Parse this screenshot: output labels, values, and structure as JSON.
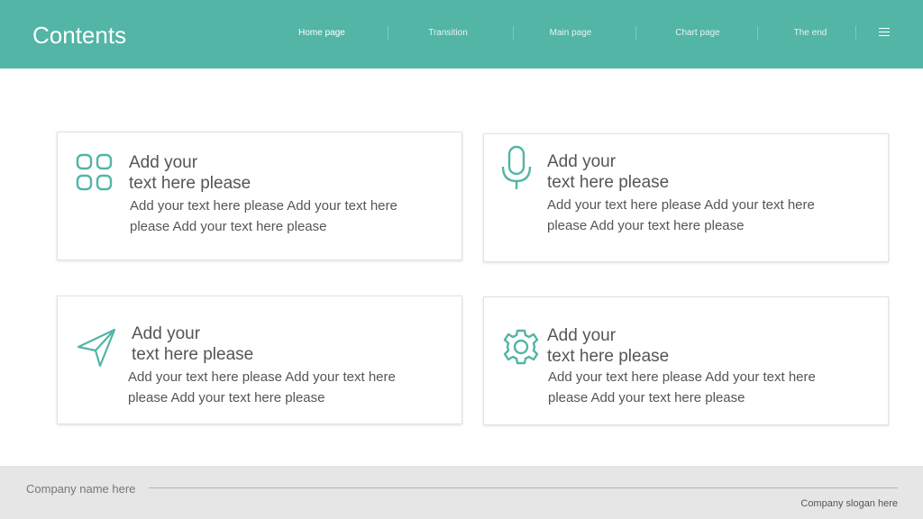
{
  "header": {
    "title": "Contents",
    "nav": [
      {
        "label": "Home  page"
      },
      {
        "label": "Transition"
      },
      {
        "label": "Main page"
      },
      {
        "label": "Chart page"
      },
      {
        "label": "The end"
      }
    ],
    "menu_icon": "menu-icon"
  },
  "colors": {
    "accent": "#52b5a6",
    "footer_bg": "#e6e6e6",
    "text": "#555555"
  },
  "cards": [
    {
      "icon": "apps-grid-icon",
      "title_line1": "Add your",
      "title_line2": "text here please",
      "body": "Add your text here please Add your text here please Add your text here please"
    },
    {
      "icon": "microphone-icon",
      "title_line1": "Add your",
      "title_line2": "text here please",
      "body": "Add your text here please Add your text here please Add your text here please"
    },
    {
      "icon": "paper-plane-icon",
      "title_line1": "Add your",
      "title_line2": "text here please",
      "body": "Add your text here please Add your text here please Add your text here please"
    },
    {
      "icon": "gear-icon",
      "title_line1": "Add your",
      "title_line2": "text here please",
      "body": "Add your text here please Add your text here please Add your text here please"
    }
  ],
  "footer": {
    "company": "Company name here",
    "slogan": "Company slogan here"
  }
}
